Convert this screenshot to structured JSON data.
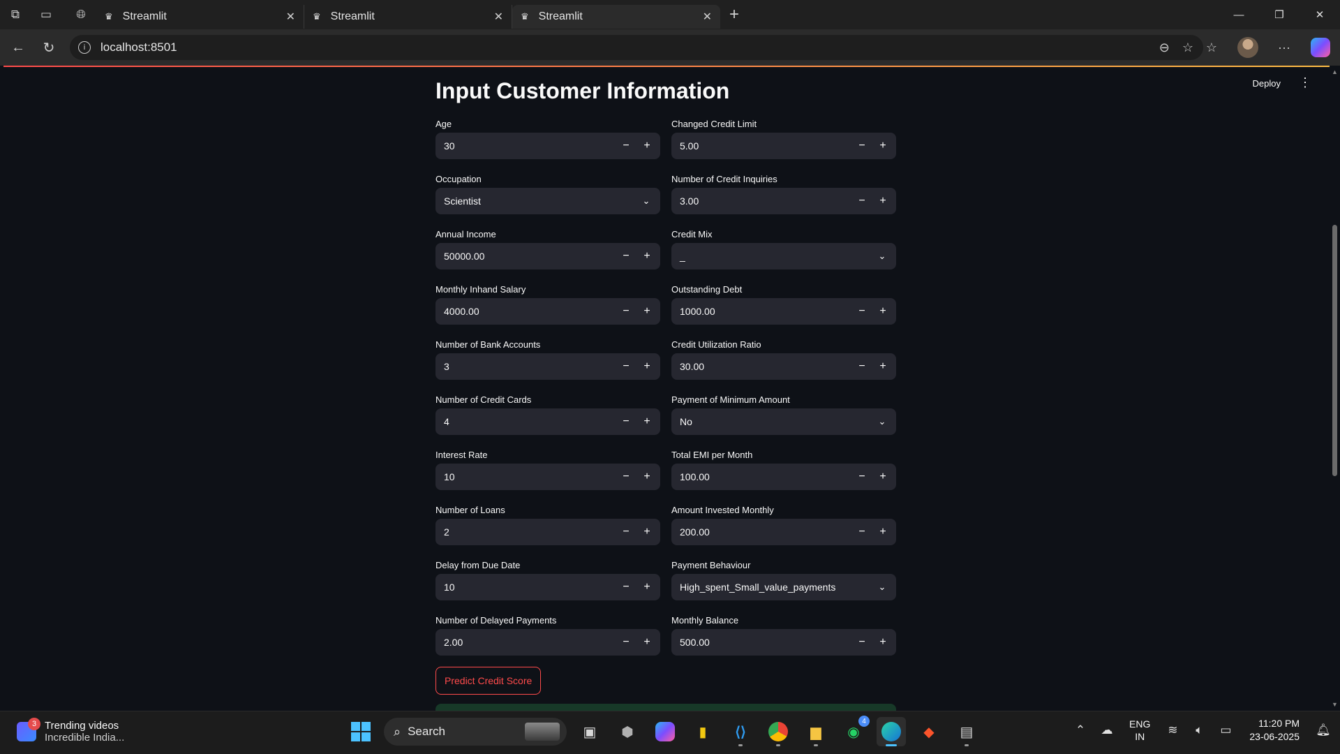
{
  "browser": {
    "tabs": [
      {
        "label": "Streamlit",
        "active": false
      },
      {
        "label": "Streamlit",
        "active": false
      },
      {
        "label": "Streamlit",
        "active": true
      }
    ],
    "url": "localhost:8501"
  },
  "app": {
    "deploy_label": "Deploy",
    "title": "Input Customer Information",
    "left_fields": [
      {
        "label": "Age",
        "value": "30",
        "type": "number"
      },
      {
        "label": "Occupation",
        "value": "Scientist",
        "type": "select"
      },
      {
        "label": "Annual Income",
        "value": "50000.00",
        "type": "number"
      },
      {
        "label": "Monthly Inhand Salary",
        "value": "4000.00",
        "type": "number"
      },
      {
        "label": "Number of Bank Accounts",
        "value": "3",
        "type": "number"
      },
      {
        "label": "Number of Credit Cards",
        "value": "4",
        "type": "number"
      },
      {
        "label": "Interest Rate",
        "value": "10",
        "type": "number"
      },
      {
        "label": "Number of Loans",
        "value": "2",
        "type": "number"
      },
      {
        "label": "Delay from Due Date",
        "value": "10",
        "type": "number"
      },
      {
        "label": "Number of Delayed Payments",
        "value": "2.00",
        "type": "number"
      }
    ],
    "right_fields": [
      {
        "label": "Changed Credit Limit",
        "value": "5.00",
        "type": "number"
      },
      {
        "label": "Number of Credit Inquiries",
        "value": "3.00",
        "type": "number"
      },
      {
        "label": "Credit Mix",
        "value": "_",
        "type": "select"
      },
      {
        "label": "Outstanding Debt",
        "value": "1000.00",
        "type": "number"
      },
      {
        "label": "Credit Utilization Ratio",
        "value": "30.00",
        "type": "number"
      },
      {
        "label": "Payment of Minimum Amount",
        "value": "No",
        "type": "select"
      },
      {
        "label": "Total EMI per Month",
        "value": "100.00",
        "type": "number"
      },
      {
        "label": "Amount Invested Monthly",
        "value": "200.00",
        "type": "number"
      },
      {
        "label": "Payment Behaviour",
        "value": "High_spent_Small_value_payments",
        "type": "select"
      },
      {
        "label": "Monthly Balance",
        "value": "500.00",
        "type": "number"
      }
    ],
    "predict_label": "Predict Credit Score",
    "accent_color": "#ff4b4b"
  },
  "taskbar": {
    "news_title": "Trending videos",
    "news_subtitle": "Incredible India...",
    "news_badge": "3",
    "search_label": "Search",
    "whatsapp_badge": "4",
    "lang_line1": "ENG",
    "lang_line2": "IN",
    "time": "11:20 PM",
    "date": "23-06-2025"
  }
}
